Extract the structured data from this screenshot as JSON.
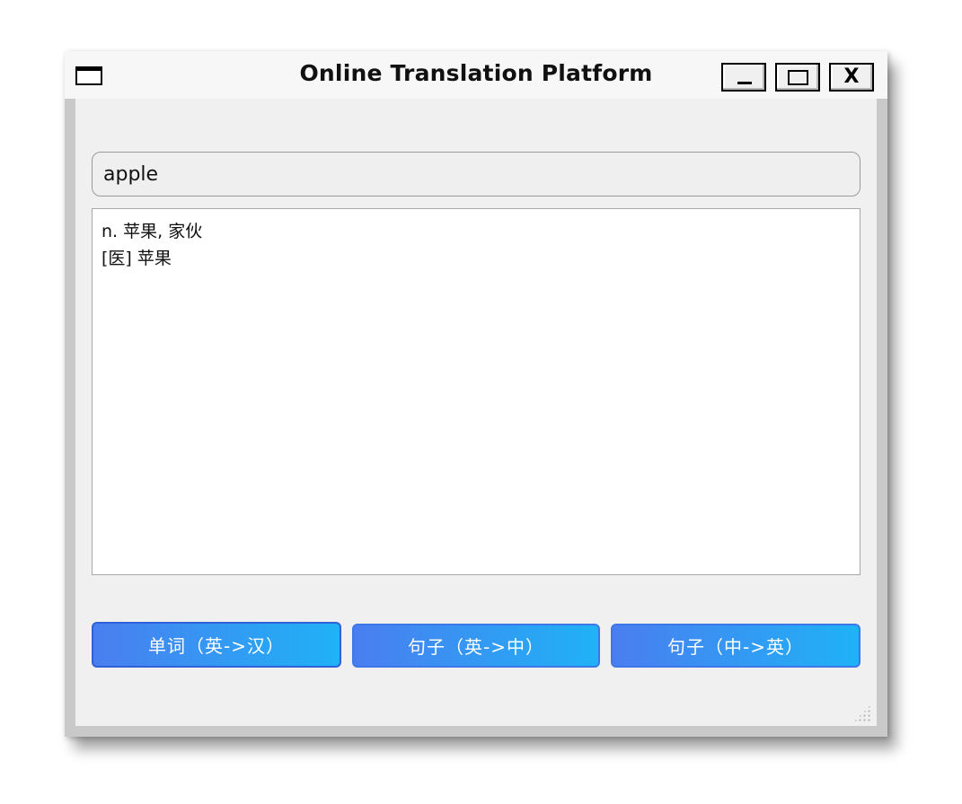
{
  "window": {
    "title": "Online Translation Platform",
    "minimize_label": "_",
    "maximize_label": "",
    "close_label": "X"
  },
  "search": {
    "value": "apple",
    "placeholder": ""
  },
  "output": {
    "lines": [
      "n. 苹果, 家伙",
      "[医] 苹果"
    ]
  },
  "buttons": [
    {
      "label": "单词（英->汉）"
    },
    {
      "label": "句子（英->中）"
    },
    {
      "label": "句子（中->英）"
    }
  ],
  "colors": {
    "button_gradient_start": "#4a7ef0",
    "button_gradient_end": "#1fb2f6",
    "window_background": "#f0f0f0"
  },
  "icons": {
    "window_menu": "window-menu-icon",
    "minimize": "minimize-icon",
    "maximize": "maximize-icon",
    "close": "close-icon",
    "resize_grip": "resize-grip-icon"
  }
}
